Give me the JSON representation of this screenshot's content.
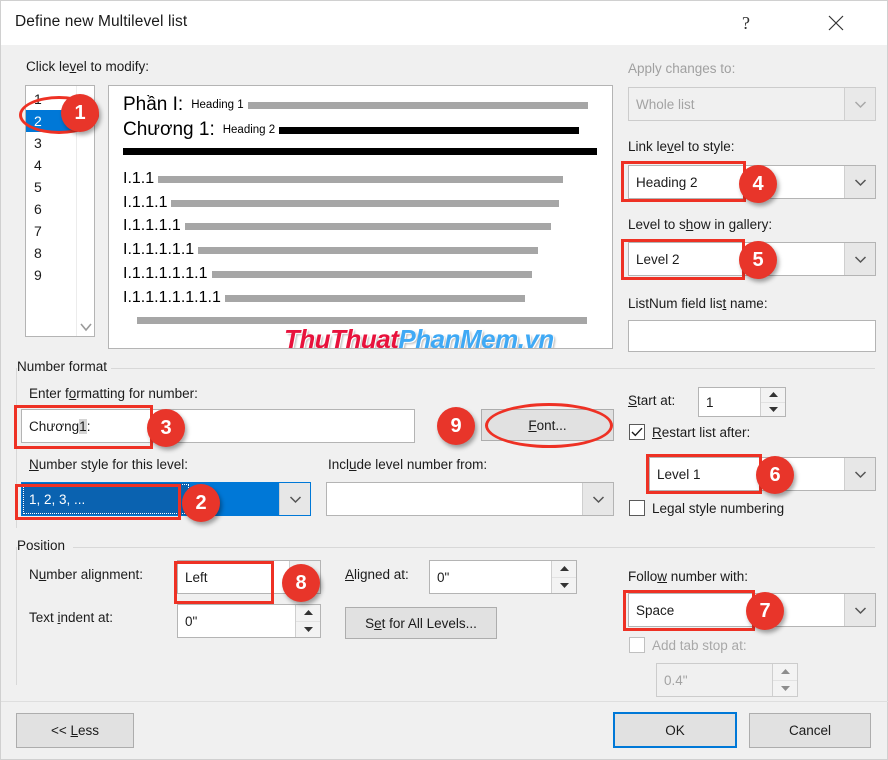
{
  "window": {
    "title": "Define new Multilevel list",
    "help_icon": "question-mark-icon",
    "close_icon": "close-icon"
  },
  "left": {
    "click_level_label": "Click level to modify:",
    "levels": [
      "1",
      "2",
      "3",
      "4",
      "5",
      "6",
      "7",
      "8",
      "9"
    ],
    "selected_level": "2"
  },
  "preview": {
    "rows": [
      {
        "num": "Phần I:",
        "style": "Heading 1"
      },
      {
        "num": "Chương 1:",
        "style": "Heading 2"
      },
      {
        "num": "",
        "style": ""
      },
      {
        "num": "I.1.1",
        "style": ""
      },
      {
        "num": "I.1.1.1",
        "style": ""
      },
      {
        "num": "I.1.1.1.1",
        "style": ""
      },
      {
        "num": "I.1.1.1.1.1",
        "style": ""
      },
      {
        "num": "I.1.1.1.1.1.1",
        "style": ""
      },
      {
        "num": "I.1.1.1.1.1.1.1",
        "style": ""
      }
    ],
    "watermark_red": "ThuThuat",
    "watermark_blue": "PhanMem.vn"
  },
  "apply": {
    "label": "Apply changes to:",
    "value": "Whole list"
  },
  "link_style": {
    "label": "Link level to style:",
    "value": "Heading 2"
  },
  "gallery": {
    "label": "Level to show in gallery:",
    "value": "Level 2"
  },
  "listnum": {
    "label": "ListNum field list name:",
    "value": ""
  },
  "number_format": {
    "group_title": "Number format",
    "enter_label": "Enter formatting for number:",
    "enter_value_prefix": "Chương ",
    "enter_value_field": "1",
    "enter_value_suffix": ":",
    "font_button": "Font...",
    "style_label": "Number style for this level:",
    "style_value": "1, 2, 3, ...",
    "include_label": "Include level number from:",
    "include_value": ""
  },
  "start_at": {
    "label": "Start at:",
    "value": "1"
  },
  "restart": {
    "label": "Restart list after:",
    "checked": true,
    "value": "Level 1"
  },
  "legal": {
    "label": "Legal style numbering",
    "checked": false
  },
  "position": {
    "group_title": "Position",
    "number_alignment_label": "Number alignment:",
    "number_alignment_value": "Left",
    "aligned_at_label": "Aligned at:",
    "aligned_at_value": "0\"",
    "text_indent_label": "Text indent at:",
    "text_indent_value": "0\"",
    "set_all_levels_button": "Set for All Levels...",
    "follow_label": "Follow number with:",
    "follow_value": "Space",
    "add_tab_label": "Add tab stop at:",
    "add_tab_value": "0.4\"",
    "add_tab_checked": false
  },
  "footer": {
    "less_button": "<< Less",
    "ok_button": "OK",
    "cancel_button": "Cancel"
  },
  "annotations": {
    "badges": [
      "1",
      "2",
      "3",
      "4",
      "5",
      "6",
      "7",
      "8",
      "9"
    ]
  },
  "colors": {
    "accent": "#0078d7",
    "annotation": "#ee3124",
    "badge": "#e8352a"
  }
}
